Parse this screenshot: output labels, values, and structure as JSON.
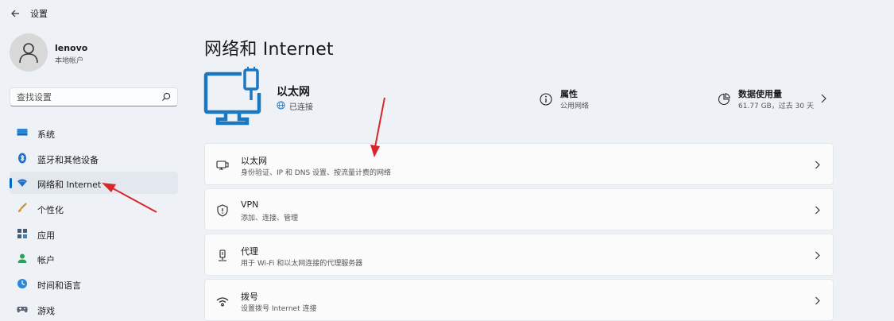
{
  "window": {
    "title": "设置",
    "back_icon": "back-arrow-icon"
  },
  "profile": {
    "name": "lenovo",
    "account_type": "本地帐户",
    "avatar_icon": "user-avatar-icon"
  },
  "search": {
    "placeholder": "查找设置",
    "icon": "search-icon"
  },
  "sidebar": {
    "items": [
      {
        "label": "系统",
        "icon": "system-icon",
        "active": false
      },
      {
        "label": "蓝牙和其他设备",
        "icon": "bluetooth-icon",
        "active": false
      },
      {
        "label": "网络和 Internet",
        "icon": "wifi-icon",
        "active": true
      },
      {
        "label": "个性化",
        "icon": "brush-icon",
        "active": false
      },
      {
        "label": "应用",
        "icon": "apps-icon",
        "active": false
      },
      {
        "label": "帐户",
        "icon": "account-icon",
        "active": false
      },
      {
        "label": "时间和语言",
        "icon": "time-language-icon",
        "active": false
      },
      {
        "label": "游戏",
        "icon": "gaming-icon",
        "active": false
      }
    ]
  },
  "main": {
    "title": "网络和 Internet",
    "connection": {
      "name": "以太网",
      "status": "已连接"
    },
    "properties": {
      "title": "属性",
      "subtitle": "公用网络"
    },
    "data_usage": {
      "title": "数据使用量",
      "subtitle": "61.77 GB，过去 30 天"
    },
    "cards": [
      {
        "title": "以太网",
        "subtitle": "身份验证、IP 和 DNS 设置、按流量计费的网络",
        "icon": "ethernet-icon"
      },
      {
        "title": "VPN",
        "subtitle": "添加、连接、管理",
        "icon": "vpn-shield-icon"
      },
      {
        "title": "代理",
        "subtitle": "用于 Wi-Fi 和以太网连接的代理服务器",
        "icon": "proxy-icon"
      },
      {
        "title": "拨号",
        "subtitle": "设置拨号 Internet 连接",
        "icon": "dialup-icon"
      }
    ]
  },
  "colors": {
    "accent": "#0067c0",
    "background": "#eef2f7",
    "annotation_arrow": "#d9262b",
    "connected": "#2b7ab8"
  }
}
